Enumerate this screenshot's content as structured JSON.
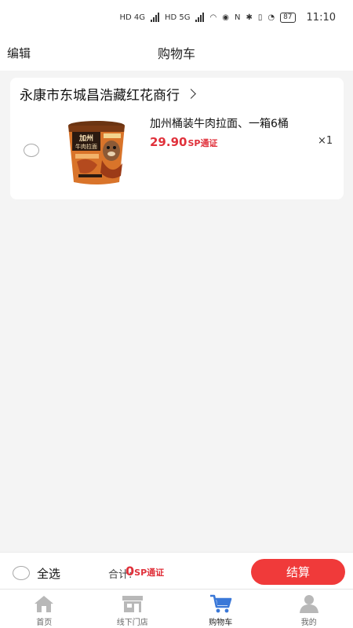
{
  "status_bar": {
    "network1": "HD 4G",
    "network2": "HD 5G",
    "battery": "87",
    "time": "11:10"
  },
  "header": {
    "edit_label": "编辑",
    "title": "购物车"
  },
  "store": {
    "name": "永康市东城昌浩藏红花商行"
  },
  "cart_item": {
    "name": "加州桶装牛肉拉面、一箱6桶",
    "price": "29.90",
    "price_unit": "SP通证",
    "quantity": "×1",
    "img_brand": "加州",
    "img_brand2": "牛肉拉面"
  },
  "checkout": {
    "select_all": "全选",
    "total_label": "合计:",
    "total_value": "0",
    "total_unit": "SP通证",
    "button": "结算"
  },
  "tabs": [
    {
      "label": "首页",
      "icon": "home-icon"
    },
    {
      "label": "线下门店",
      "icon": "store-icon"
    },
    {
      "label": "购物车",
      "icon": "cart-icon"
    },
    {
      "label": "我的",
      "icon": "profile-icon"
    }
  ],
  "colors": {
    "accent": "#e0313b",
    "button": "#f03a3a",
    "active_tab": "#3a78d8",
    "inactive_tab": "#b8b8b8"
  }
}
